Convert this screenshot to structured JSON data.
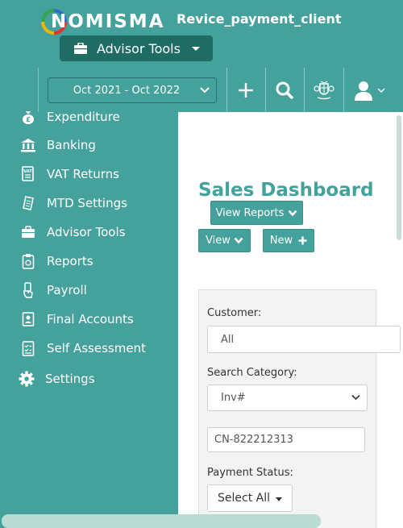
{
  "header": {
    "logo_text": "NOMISMA",
    "client_name": "Revice_payment_client",
    "advisor_button_label": "Advisor Tools",
    "date_range": "Oct 2021 - Oct 2022",
    "icons": [
      "plus-icon",
      "search-icon",
      "crest-icon",
      "user-icon"
    ]
  },
  "sidebar": {
    "items": [
      {
        "label": "Expenditure",
        "icon": "money-bag-icon"
      },
      {
        "label": "Banking",
        "icon": "bank-icon"
      },
      {
        "label": "VAT Returns",
        "icon": "vat-document-icon"
      },
      {
        "label": "MTD Settings",
        "icon": "receipt-icon"
      },
      {
        "label": "Advisor Tools",
        "icon": "briefcase-icon"
      },
      {
        "label": "Reports",
        "icon": "clipboard-icon"
      },
      {
        "label": "Payroll",
        "icon": "hand-money-icon"
      },
      {
        "label": "Final Accounts",
        "icon": "id-card-icon"
      },
      {
        "label": "Self Assessment",
        "icon": "checklist-icon"
      },
      {
        "label": "Settings",
        "icon": "gear-icon"
      }
    ]
  },
  "main": {
    "title": "Sales Dashboard",
    "view_reports_label": "View Reports",
    "view_label": "View",
    "new_label": "New",
    "filters": {
      "customer_label": "Customer:",
      "customer_value": "All",
      "search_category_label": "Search Category:",
      "search_category_value": "Inv#",
      "search_value": "CN-822212313",
      "payment_status_label": "Payment Status:",
      "payment_status_value": "Select All"
    }
  },
  "colors": {
    "teal": "#45a19b",
    "dark_teal": "#1e6c63",
    "white": "#ffffff"
  }
}
